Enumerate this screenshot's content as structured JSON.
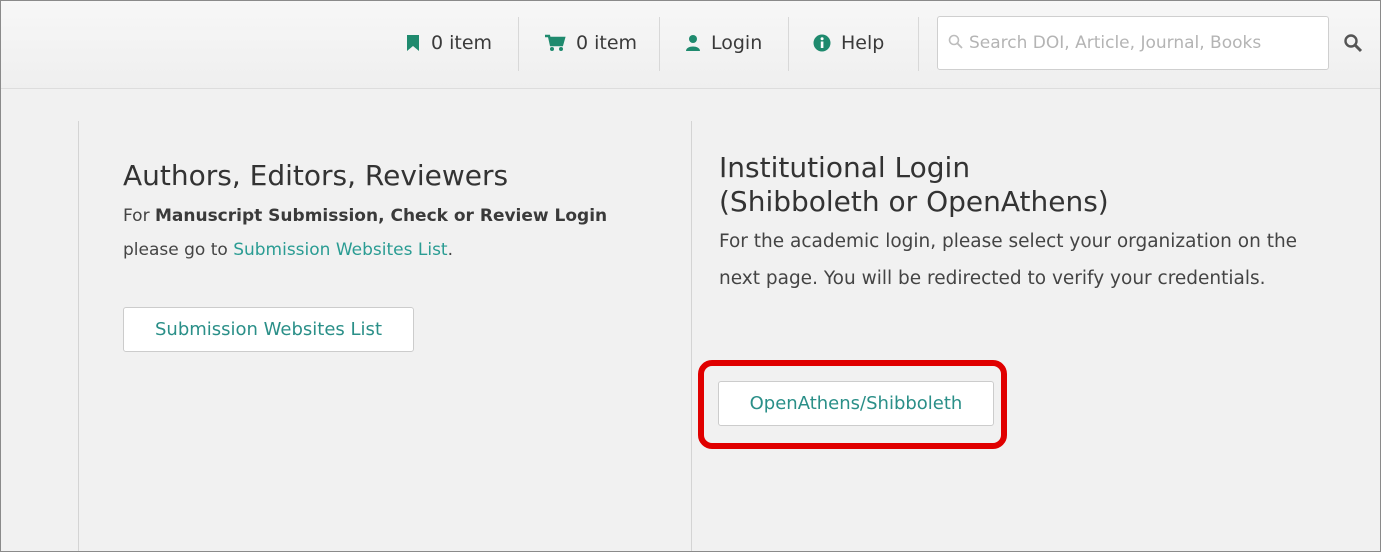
{
  "topbar": {
    "bookmarks": {
      "label": "0 item",
      "icon": "bookmark-icon"
    },
    "cart": {
      "label": "0 item",
      "icon": "cart-icon"
    },
    "login": {
      "label": "Login",
      "icon": "user-icon"
    },
    "help": {
      "label": "Help",
      "icon": "info-circle-icon"
    },
    "search": {
      "placeholder": "Search DOI, Article, Journal, Books",
      "icon": "search-icon"
    }
  },
  "left": {
    "title": "Authors, Editors, Reviewers",
    "text_prefix": "For ",
    "text_bold": "Manuscript Submission, Check or Review Login",
    "text_mid": " please go to ",
    "text_link": "Submission Websites List",
    "text_suffix": ".",
    "button_label": "Submission Websites List"
  },
  "right": {
    "title_line1": "Institutional Login",
    "title_line2": "(Shibboleth or OpenAthens)",
    "text": "For the academic login, please select your organization on the next page. You will be redirected to verify your credentials.",
    "button_label": "OpenAthens/Shibboleth"
  },
  "colors": {
    "accent": "#2a9c93",
    "icon_green": "#1f8a6e",
    "highlight": "#e00000"
  }
}
